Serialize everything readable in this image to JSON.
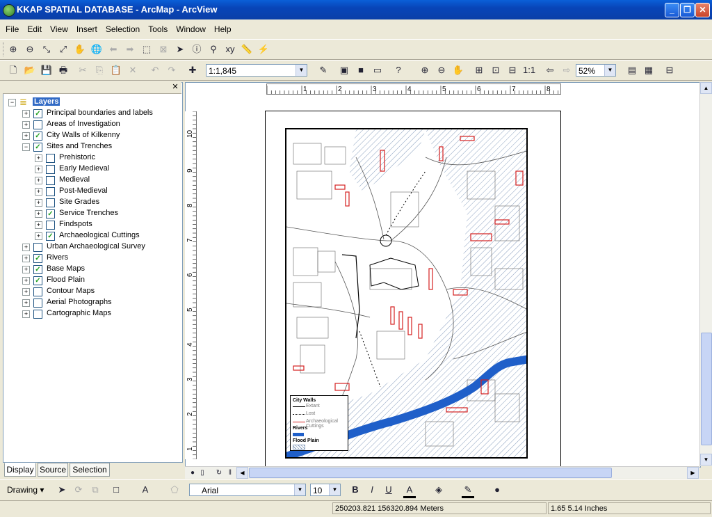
{
  "window": {
    "title": "KKAP SPATIAL DATABASE - ArcMap - ArcView"
  },
  "menu": [
    "File",
    "Edit",
    "View",
    "Insert",
    "Selection",
    "Tools",
    "Window",
    "Help"
  ],
  "toolbar2": {
    "scale": "1:1,845",
    "zoom": "52%"
  },
  "toc": {
    "root": "Layers",
    "layers": [
      {
        "label": "Principal boundaries and labels",
        "checked": true,
        "indent": 0,
        "expand": "+"
      },
      {
        "label": "Areas of Investigation",
        "checked": false,
        "indent": 0,
        "expand": "+"
      },
      {
        "label": "City Walls of Kilkenny",
        "checked": true,
        "indent": 0,
        "expand": "+"
      },
      {
        "label": "Sites and Trenches",
        "checked": true,
        "indent": 0,
        "expand": "−"
      },
      {
        "label": "Prehistoric",
        "checked": false,
        "indent": 1,
        "expand": "+"
      },
      {
        "label": "Early Medieval",
        "checked": false,
        "indent": 1,
        "expand": "+"
      },
      {
        "label": "Medieval",
        "checked": false,
        "indent": 1,
        "expand": "+"
      },
      {
        "label": "Post-Medieval",
        "checked": false,
        "indent": 1,
        "expand": "+"
      },
      {
        "label": "Site Grades",
        "checked": false,
        "indent": 1,
        "expand": "+"
      },
      {
        "label": "Service Trenches",
        "checked": true,
        "indent": 1,
        "expand": "+"
      },
      {
        "label": "Findspots",
        "checked": false,
        "indent": 1,
        "expand": "+"
      },
      {
        "label": "Archaeological Cuttings",
        "checked": true,
        "indent": 1,
        "expand": "+"
      },
      {
        "label": "Urban Archaeological Survey",
        "checked": false,
        "indent": 0,
        "expand": "+"
      },
      {
        "label": "Rivers",
        "checked": true,
        "indent": 0,
        "expand": "+"
      },
      {
        "label": "Base Maps",
        "checked": true,
        "indent": 0,
        "expand": "+"
      },
      {
        "label": "Flood Plain",
        "checked": true,
        "indent": 0,
        "expand": "+"
      },
      {
        "label": "Contour Maps",
        "checked": false,
        "indent": 0,
        "expand": "+"
      },
      {
        "label": "Aerial Photographs",
        "checked": false,
        "indent": 0,
        "expand": "+"
      },
      {
        "label": "Cartographic Maps",
        "checked": false,
        "indent": 0,
        "expand": "+"
      }
    ]
  },
  "tabs": [
    "Display",
    "Source",
    "Selection"
  ],
  "ruler": {
    "h": [
      "1",
      "2",
      "3",
      "4",
      "5",
      "6",
      "7",
      "8"
    ],
    "v": [
      "10",
      "9",
      "8",
      "7",
      "6",
      "5",
      "4",
      "3",
      "2",
      "1"
    ]
  },
  "legend": {
    "title": "City Walls",
    "items": [
      "Extant",
      "Lost",
      "Archaeological Cuttings"
    ],
    "rivers": "Rivers",
    "flood": "Flood Plain"
  },
  "drawing": {
    "label": "Drawing",
    "font": "Arial",
    "size": "10"
  },
  "status": {
    "coords": "250203.821  156320.894 Meters",
    "page": "1.65  5.14 Inches"
  }
}
